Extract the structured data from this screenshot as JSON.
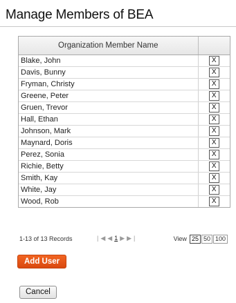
{
  "page": {
    "title": "Manage Members of BEA"
  },
  "table": {
    "column_header": "Organization Member Name",
    "delete_label": "X",
    "members": [
      "Blake, John",
      "Davis, Bunny",
      "Fryman, Christy",
      "Greene, Peter",
      "Gruen, Trevor",
      "Hall, Ethan",
      "Johnson, Mark",
      "Maynard, Doris",
      "Perez, Sonia",
      "Richie, Betty",
      "Smith, Kay",
      "White, Jay",
      "Wood, Rob"
    ]
  },
  "pager": {
    "records": "1-13 of 13 Records",
    "first_icon": "first-page-icon",
    "prev_icon": "prev-page-icon",
    "current_page": "1",
    "next_icon": "next-page-icon",
    "last_icon": "last-page-icon",
    "view_label": "View",
    "view_options": [
      "25",
      "50",
      "100"
    ],
    "view_selected": "25"
  },
  "actions": {
    "add_user": "Add User",
    "cancel": "Cancel"
  },
  "colors": {
    "accent": "#e8581a"
  }
}
